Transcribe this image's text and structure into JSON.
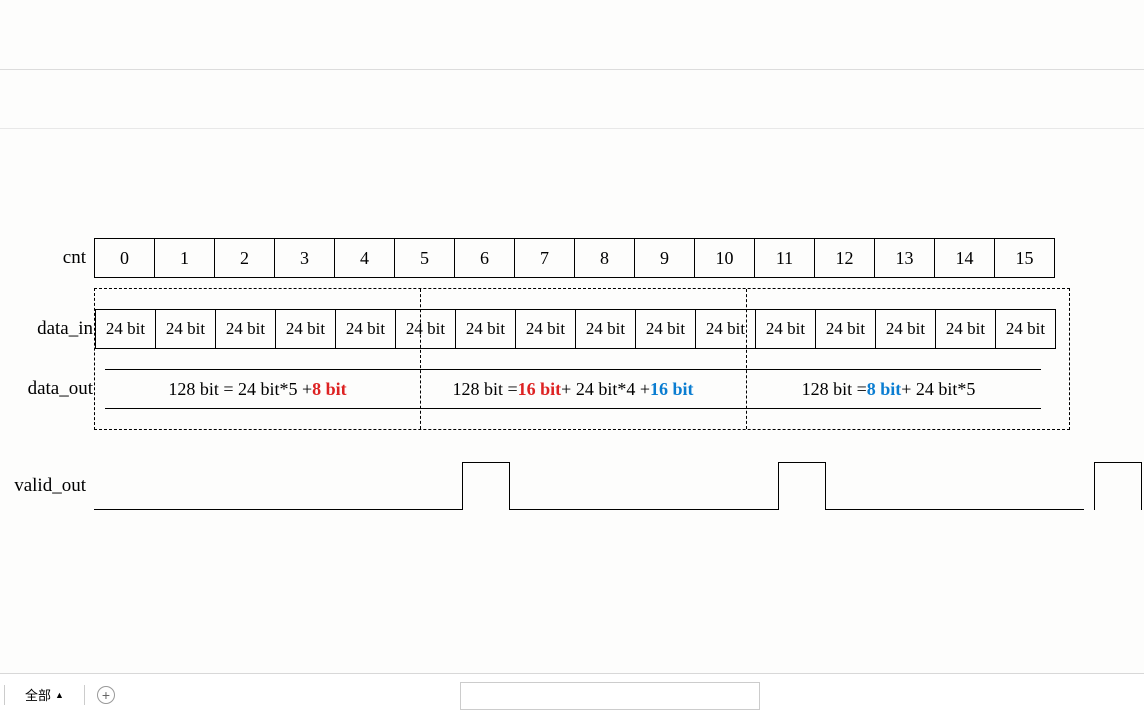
{
  "labels": {
    "cnt": "cnt",
    "data_in": "data_in",
    "data_out": "data_out",
    "valid_out": "valid_out"
  },
  "cnt": [
    "0",
    "1",
    "2",
    "3",
    "4",
    "5",
    "6",
    "7",
    "8",
    "9",
    "10",
    "11",
    "12",
    "13",
    "14",
    "15"
  ],
  "data_in_cell": "24 bit",
  "data_out": {
    "seg1": {
      "prefix": "128 bit = 24 bit*5 + ",
      "h1": "8 bit"
    },
    "seg2": {
      "prefix": "128 bit = ",
      "h1": "16 bit",
      "mid": " + 24 bit*4 + ",
      "h2": "16 bit"
    },
    "seg3": {
      "prefix": "128 bit = ",
      "h1": "8 bit",
      "suffix": " + 24 bit*5"
    }
  },
  "footer": {
    "all_label": "全部"
  }
}
